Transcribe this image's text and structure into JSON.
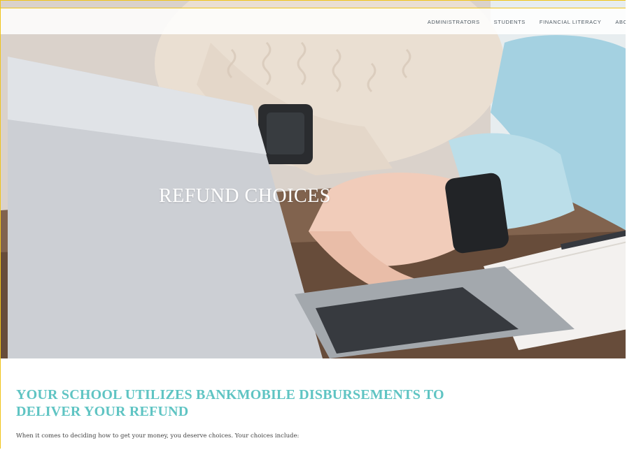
{
  "nav": {
    "items": [
      "ADMINISTRATORS",
      "STUDENTS",
      "FINANCIAL LITERACY",
      "ABO"
    ]
  },
  "hero": {
    "title": "REFUND CHOICES"
  },
  "content": {
    "heading_line1": "YOUR SCHOOL UTILIZES BANKMOBILE DISBURSEMENTS TO",
    "heading_line2": "DELIVER YOUR REFUND",
    "intro": "When it comes to deciding how to get your money, you deserve choices. Your choices include:"
  },
  "colors": {
    "accent": "#5fc4c3",
    "nav_text": "#4f5a63",
    "frame": "#f0c419"
  }
}
